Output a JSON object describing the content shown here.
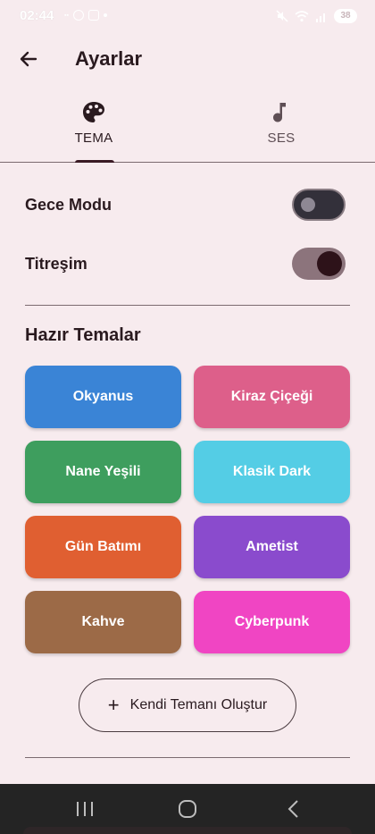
{
  "status_bar": {
    "time": "02:44",
    "battery": "38"
  },
  "app_bar": {
    "title": "Ayarlar",
    "back_icon": "arrow-left-icon"
  },
  "tabs": [
    {
      "label": "TEMA",
      "icon": "palette-icon",
      "selected": true
    },
    {
      "label": "SES",
      "icon": "music-note-icon",
      "selected": false
    }
  ],
  "settings": {
    "night_mode": {
      "label": "Gece Modu",
      "enabled": false
    },
    "vibration": {
      "label": "Titreşim",
      "enabled": true
    }
  },
  "themes_section": {
    "title": "Hazır Temalar",
    "themes": [
      {
        "label": "Okyanus",
        "color": "#3a84d6"
      },
      {
        "label": "Kiraz Çiçeği",
        "color": "#dd5f8a"
      },
      {
        "label": "Nane Yeşili",
        "color": "#3e9e5e"
      },
      {
        "label": "Klasik Dark",
        "color": "#54cde5"
      },
      {
        "label": "Gün Batımı",
        "color": "#e05f31"
      },
      {
        "label": "Ametist",
        "color": "#8a4bcd"
      },
      {
        "label": "Kahve",
        "color": "#9c6a47"
      },
      {
        "label": "Cyberpunk",
        "color": "#f045c3"
      }
    ]
  },
  "create_button": {
    "label": "Kendi Temanı Oluştur",
    "icon": "plus-icon"
  },
  "colors": {
    "background": "#f7ebee",
    "text": "#2a1a1f",
    "accent": "#3a1a24"
  }
}
